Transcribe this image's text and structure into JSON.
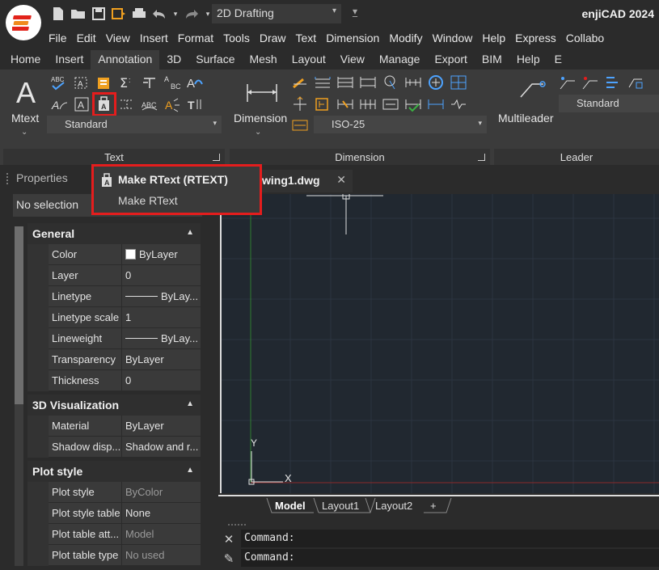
{
  "app": {
    "title": "enjiCAD 2024",
    "workspace": "2D Drafting"
  },
  "menubar": {
    "items": [
      "File",
      "Edit",
      "View",
      "Insert",
      "Format",
      "Tools",
      "Draw",
      "Text",
      "Dimension",
      "Modify",
      "Window",
      "Help",
      "Express",
      "Collabo"
    ]
  },
  "ribbon_tabs": {
    "items": [
      "Home",
      "Insert",
      "Annotation",
      "3D",
      "Surface",
      "Mesh",
      "Layout",
      "View",
      "Manage",
      "Export",
      "BIM",
      "Help",
      "E"
    ],
    "active": "Annotation"
  },
  "ribbon": {
    "text_panel": {
      "title": "Text",
      "big_button": "Mtext",
      "style_combo": "Standard"
    },
    "dimension_panel": {
      "title": "Dimension",
      "big_button": "Dimension",
      "style_combo": "ISO-25"
    },
    "leader_panel": {
      "title": "Leader",
      "big_button": "Multileader",
      "style_combo": "Standard"
    }
  },
  "tooltip": {
    "title": "Make RText (RTEXT)",
    "description": "Make RText"
  },
  "properties": {
    "title": "Properties",
    "selection": "No selection",
    "sections": [
      {
        "name": "General",
        "rows": [
          {
            "name": "Color",
            "value": "ByLayer"
          },
          {
            "name": "Layer",
            "value": "0"
          },
          {
            "name": "Linetype",
            "value": "ByLay..."
          },
          {
            "name": "Linetype scale",
            "value": "1"
          },
          {
            "name": "Lineweight",
            "value": "ByLay..."
          },
          {
            "name": "Transparency",
            "value": "ByLayer"
          },
          {
            "name": "Thickness",
            "value": "0"
          }
        ]
      },
      {
        "name": "3D Visualization",
        "rows": [
          {
            "name": "Material",
            "value": "ByLayer"
          },
          {
            "name": "Shadow disp...",
            "value": "Shadow and r..."
          }
        ]
      },
      {
        "name": "Plot style",
        "rows": [
          {
            "name": "Plot style",
            "value": "ByColor"
          },
          {
            "name": "Plot style table",
            "value": "None"
          },
          {
            "name": "Plot table att...",
            "value": "Model"
          },
          {
            "name": "Plot table type",
            "value": "No used"
          }
        ]
      }
    ]
  },
  "document": {
    "tab_label": "wing1.dwg",
    "close_glyph": "✕"
  },
  "canvas": {
    "ucs_x_label": "X",
    "ucs_y_label": "Y"
  },
  "layout_tabs": {
    "items": [
      "Model",
      "Layout1",
      "Layout2",
      "+"
    ],
    "active": "Model"
  },
  "command": {
    "lines": [
      "Command:",
      "Command:"
    ]
  },
  "colors": {
    "highlight": "#e41d1d",
    "canvas_bg": "#212830",
    "y_axis": "#2f7d2f",
    "x_axis": "#8a2a2a"
  }
}
